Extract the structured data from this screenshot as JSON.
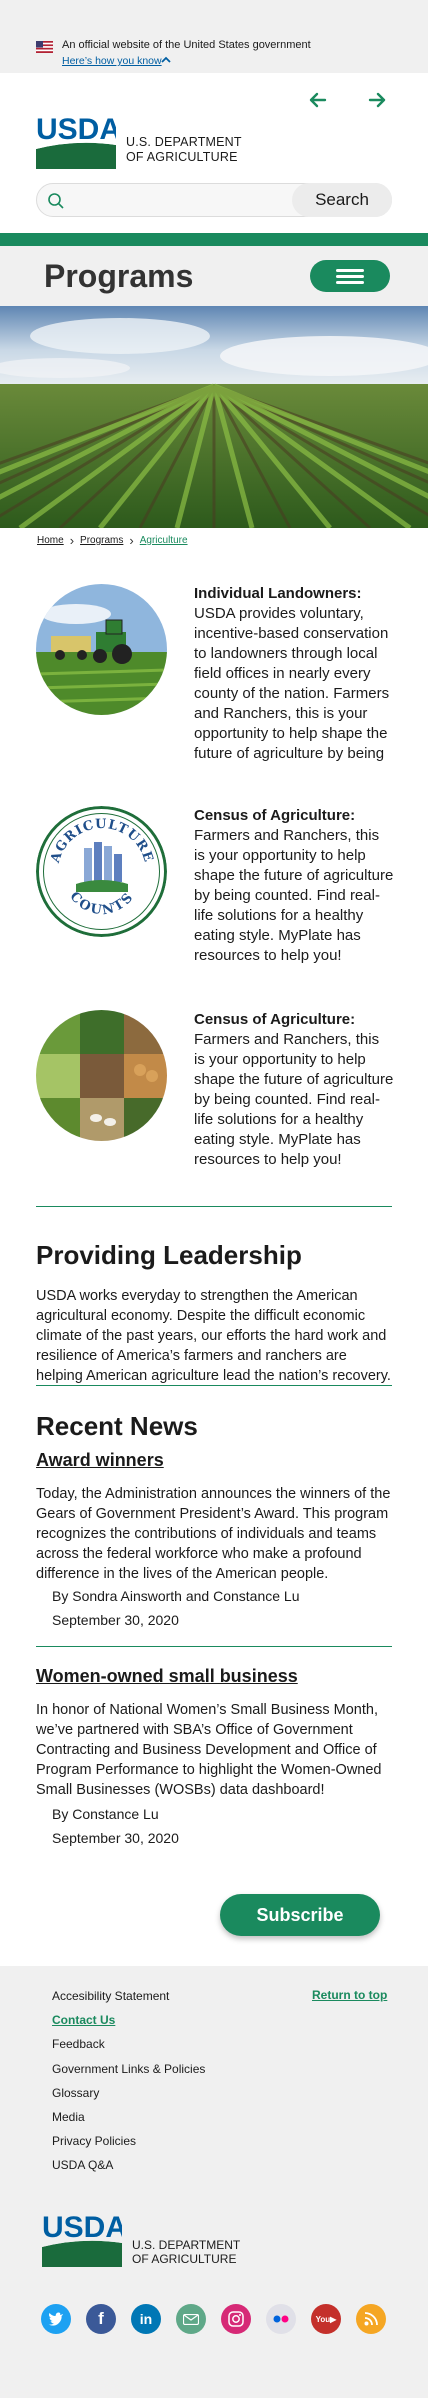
{
  "gov_banner": {
    "text": "An official website of the United States government",
    "link": "Here’s how you know"
  },
  "header": {
    "logo_text": "USDA",
    "dept_line1": "U.S. DEPARTMENT",
    "dept_line2": "OF AGRICULTURE",
    "search": {
      "placeholder": "",
      "button_label": "Search"
    }
  },
  "programs": {
    "title": "Programs"
  },
  "breadcrumb": [
    "Home",
    "Programs",
    "Agriculture"
  ],
  "features": [
    {
      "title": "Individual Landowners:",
      "body": " USDA provides voluntary, incentive-based conservation to landowners through local field offices in nearly every county of the nation. Farmers and Ranchers, this is your opportunity to help shape the future of agriculture by being"
    },
    {
      "title": "Census of Agriculture:",
      "body": " Farmers and Ranchers, this is your opportunity to help shape the future of agriculture by being counted. Find real-life solutions for a healthy eating style. MyPlate has resources to help you!",
      "seal_top": "AGRICULTURE",
      "seal_bottom": "COUNTS"
    },
    {
      "title": "Census of Agriculture:",
      "body": " Farmers and Ranchers, this is your opportunity to help shape the future of agriculture by being counted. Find real-life solutions for a healthy eating style. MyPlate has resources to help you!"
    }
  ],
  "leadership": {
    "title": "Providing Leadership",
    "body": "USDA works everyday to strengthen the American agricultural economy. Despite the difficult economic climate of the past years, our efforts the hard work and resilience of America’s farmers and ranchers are helping American agriculture lead the nation’s recovery."
  },
  "news": {
    "title": "Recent News",
    "items": [
      {
        "title": "Award winners",
        "body": "Today, the Administration announces the winners of the Gears of Government President’s Award. This program recognizes the contributions of individuals and teams across the federal workforce who make a profound difference in the lives of the American people.",
        "author": "By Sondra Ainsworth and Constance Lu",
        "date": "September 30, 2020"
      },
      {
        "title": "Women-owned small business",
        "body": "In honor of National Women’s Small Business Month, we’ve partnered with SBA’s Office of Government Contracting and Business Development and Office of Program Performance to highlight the Women-Owned Small Businesses (WOSBs) data dashboard!",
        "author": "By Constance Lu",
        "date": "September 30, 2020"
      }
    ],
    "subscribe_label": "Subscribe"
  },
  "footer": {
    "links": [
      "Accesibility Statement",
      "Contact Us",
      "Feedback",
      "Government Links & Policies",
      "Glossary",
      "Media",
      "Privacy Policies",
      "USDA Q&A"
    ],
    "active_link": "Contact Us",
    "return_to_top": "Return to top",
    "social": [
      {
        "icon": "twitter-icon",
        "color": "#1da1f2"
      },
      {
        "icon": "facebook-icon",
        "color": "#3b5998"
      },
      {
        "icon": "linkedin-icon",
        "color": "#0077b5"
      },
      {
        "icon": "email-icon",
        "color": "#5fa888"
      },
      {
        "icon": "instagram-icon",
        "color": "#d62976"
      },
      {
        "icon": "flickr-icon",
        "color": "#e0e0e8"
      },
      {
        "icon": "youtube-icon",
        "color": "#c4302b"
      },
      {
        "icon": "rss-icon",
        "color": "#f5a623"
      }
    ]
  },
  "colors": {
    "brand_green": "#1a8a5e",
    "usda_blue": "#005ea2"
  }
}
